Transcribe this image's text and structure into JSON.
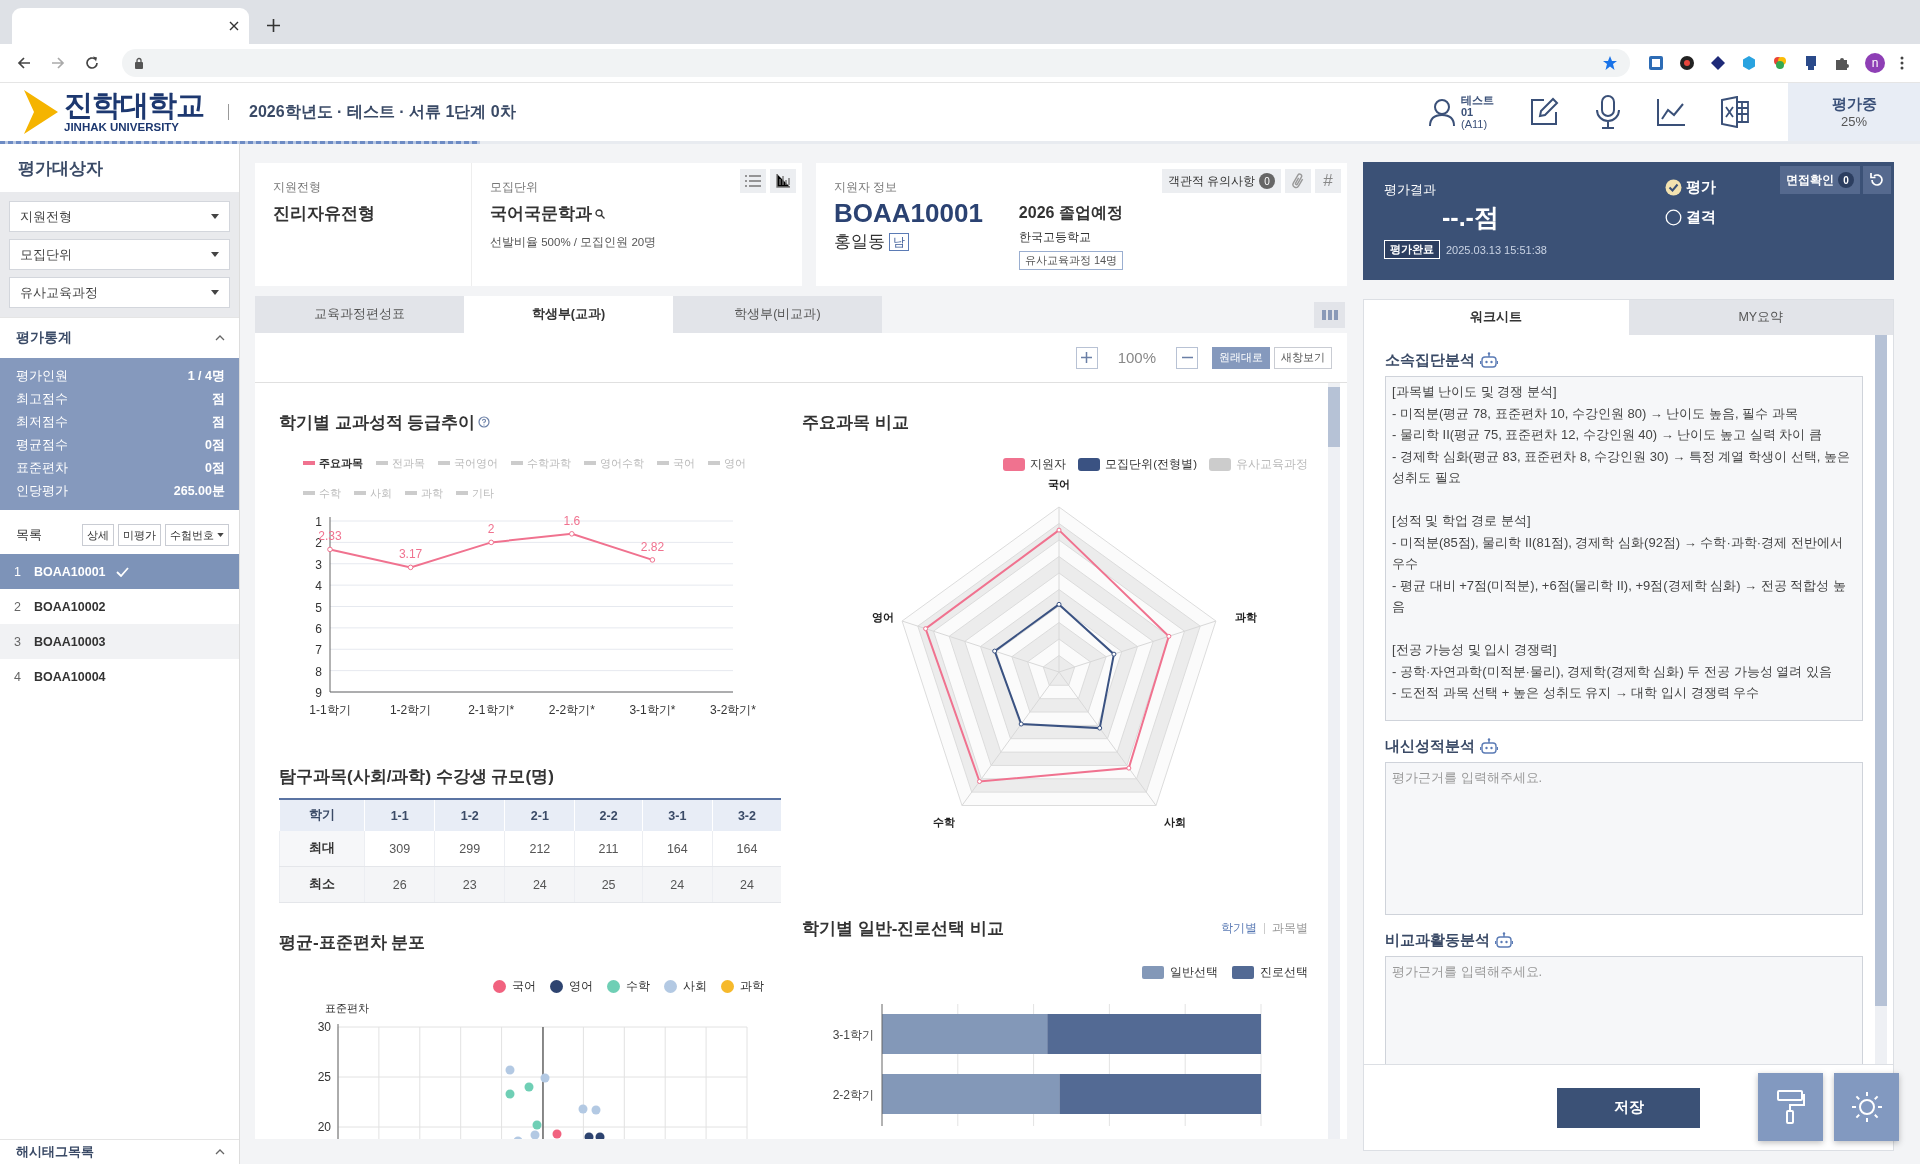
{
  "browser": {
    "profile_initial": "n"
  },
  "header": {
    "logo": {
      "name": "진학대학교",
      "subtitle": "JINHAK UNIVERSITY"
    },
    "breadcrumb": "2026학년도 · 테스트 · 서류 1단계 0차",
    "user": {
      "name": "테스트",
      "id": "01",
      "code": "(A11)"
    },
    "progress": {
      "label": "평가중",
      "reading": "25%",
      "level": 0.25
    }
  },
  "sidebar": {
    "title": "평가대상자",
    "filters": [
      {
        "value": "지원전형"
      },
      {
        "value": "모집단위"
      },
      {
        "value": "유사교육과정"
      }
    ],
    "stats": {
      "title": "평가통계",
      "expanded": true,
      "rows": [
        {
          "label": "평가인원",
          "value": "1 / 4명"
        },
        {
          "label": "최고점수",
          "value": "점"
        },
        {
          "label": "최저점수",
          "value": "점"
        },
        {
          "label": "평균점수",
          "value": "0점"
        },
        {
          "label": "표준편차",
          "value": "0점"
        },
        {
          "label": "인당평가",
          "value": "265.00분"
        }
      ]
    },
    "list": {
      "title": "목록",
      "buttons": [
        "상세",
        "미평가"
      ],
      "sort": "수험번호",
      "items": [
        {
          "index": "1",
          "id": "BOAA10001",
          "selected": true,
          "done": true,
          "highlighted": false
        },
        {
          "index": "2",
          "id": "BOAA10002",
          "selected": false,
          "done": false,
          "highlighted": false
        },
        {
          "index": "3",
          "id": "BOAA10003",
          "selected": false,
          "done": false,
          "highlighted": true
        },
        {
          "index": "4",
          "id": "BOAA10004",
          "selected": false,
          "done": false,
          "highlighted": false
        }
      ]
    },
    "hashtags": {
      "title": "해시태그목록",
      "expanded": true
    }
  },
  "applicant": {
    "track": {
      "label": "지원전형",
      "value": "진리자유전형"
    },
    "unit": {
      "label": "모집단위",
      "value": "국어국문학과",
      "detail": "선발비율 500% / 모집인원 20명"
    },
    "info": {
      "label": "지원자 정보",
      "id": "BOAA10001",
      "name": "홍일동",
      "gender": "남",
      "graduation": "2026 졸업예정",
      "school": "한국고등학교",
      "similar": "유사교육과정 14명"
    },
    "notes": {
      "label": "객관적 유의사항",
      "count": "0"
    },
    "hash": "#"
  },
  "tabs": [
    {
      "label": "교육과정편성표",
      "selected": false
    },
    {
      "label": "학생부(교과)",
      "selected": true
    },
    {
      "label": "학생부(비교과)",
      "selected": false
    }
  ],
  "zoom": {
    "reading": "100%",
    "buttons": [
      {
        "label": "원래대로",
        "selected": true
      },
      {
        "label": "새창보기",
        "selected": false
      }
    ]
  },
  "grade_trend": {
    "title": "학기별 교과성적 등급추이",
    "legend": [
      {
        "label": "전과목",
        "on": false
      },
      {
        "label": "국어영어",
        "on": false
      },
      {
        "label": "수학과학",
        "on": false
      },
      {
        "label": "영어수학",
        "on": false
      },
      {
        "label": "국어",
        "on": false
      },
      {
        "label": "영어",
        "on": false
      },
      {
        "label": "수학",
        "on": false
      },
      {
        "label": "사회",
        "on": false
      },
      {
        "label": "과학",
        "on": false
      },
      {
        "label": "기타",
        "on": false
      }
    ],
    "chart_data": {
      "type": "line",
      "categories": [
        "1-1학기",
        "1-2학기",
        "2-1학기*",
        "2-2학기*",
        "3-1학기*",
        "3-2학기*"
      ],
      "series": [
        {
          "name": "주요과목",
          "color": "#f0728f",
          "marker": true,
          "values": [
            2.33,
            3.17,
            2,
            1.6,
            2.82,
            null
          ]
        }
      ],
      "grid": true,
      "ylim": [
        9,
        1
      ],
      "yticks": [
        1,
        2,
        3,
        4,
        5,
        6,
        7,
        8,
        9
      ],
      "data_labels": true
    }
  },
  "enrollment_table": {
    "title": "탐구과목(사회/과학) 수강생 규모(명)",
    "columns": [
      "학기",
      "1-1",
      "1-2",
      "2-1",
      "2-2",
      "3-1",
      "3-2"
    ],
    "rows": [
      [
        "최대",
        "309",
        "299",
        "212",
        "211",
        "164",
        "164"
      ],
      [
        "최소",
        "26",
        "23",
        "24",
        "25",
        "24",
        "24"
      ]
    ]
  },
  "distribution": {
    "title": "평균-표준편차 분포",
    "legend": [
      {
        "label": "국어",
        "color": "#f1627f"
      },
      {
        "label": "영어",
        "color": "#2e4470"
      },
      {
        "label": "수학",
        "color": "#6fcfb5"
      },
      {
        "label": "사회",
        "color": "#b3c9e3"
      },
      {
        "label": "과학",
        "color": "#f6b92b"
      }
    ],
    "ylabel": "표준편차",
    "yticks": [
      "30",
      "25",
      "20"
    ]
  },
  "comparison": {
    "title": "주요과목 비교",
    "legend": [
      {
        "label": "지원자",
        "color": "#f0728f",
        "on": true
      },
      {
        "label": "모집단위(전형별)",
        "color": "#3a5282",
        "on": true
      },
      {
        "label": "유사교육과정",
        "color": "#cccccc",
        "on": false
      }
    ],
    "axes": [
      "국어",
      "과학",
      "사회",
      "수학",
      "영어"
    ]
  },
  "choice": {
    "title": "학기별 일반-진로선택 비교",
    "toggle": [
      {
        "label": "학기별",
        "selected": true
      },
      {
        "label": "과목별",
        "selected": false
      }
    ],
    "legend": [
      {
        "label": "일반선택",
        "color": "#8398b8"
      },
      {
        "label": "진로선택",
        "color": "#536a94"
      }
    ],
    "categories": [
      "3-1학기",
      "2-2학기"
    ]
  },
  "result": {
    "title": "평가결과",
    "score": "--.-점",
    "status": "평가완료",
    "time": "2025.03.13 15:51:38",
    "options": [
      {
        "label": "평가",
        "selected": true
      },
      {
        "label": "결격",
        "selected": false
      }
    ],
    "interview": {
      "label": "면접확인",
      "count": "0"
    }
  },
  "worksheet": {
    "tabs": [
      {
        "label": "워크시트",
        "selected": true
      },
      {
        "label": "MY요약",
        "selected": false
      }
    ],
    "sections": [
      {
        "title": "소속집단분석",
        "value": "[과목별 난이도 및 경쟁 분석]\n- 미적분(평균 78, 표준편차 10, 수강인원 80) → 난이도 높음, 필수 과목\n- 물리학 II(평균 75, 표준편차 12, 수강인원 40) → 난이도 높고 실력 차이 큼\n- 경제학 심화(평균 83, 표준편차 8, 수강인원 30) → 특정 계열 학생이 선택, 높은 성취도 필요\n\n[성적 및 학업 경로 분석]\n- 미적분(85점), 물리학 II(81점), 경제학 심화(92점) → 수학·과학·경제 전반에서 우수\n- 평균 대비 +7점(미적분), +6점(물리학 II), +9점(경제학 심화) → 전공 적합성 높음\n\n[전공 가능성 및 입시 경쟁력]\n- 공학·자연과학(미적분·물리), 경제학(경제학 심화) 두 전공 가능성 열려 있음\n- 도전적 과목 선택 + 높은 성취도 유지 → 대학 입시 경쟁력 우수"
      },
      {
        "title": "내신성적분석",
        "placeholder": "평가근거를 입력해주세요."
      },
      {
        "title": "비교과활동분석",
        "placeholder": "평가근거를 입력해주세요."
      }
    ],
    "save": "저장"
  }
}
